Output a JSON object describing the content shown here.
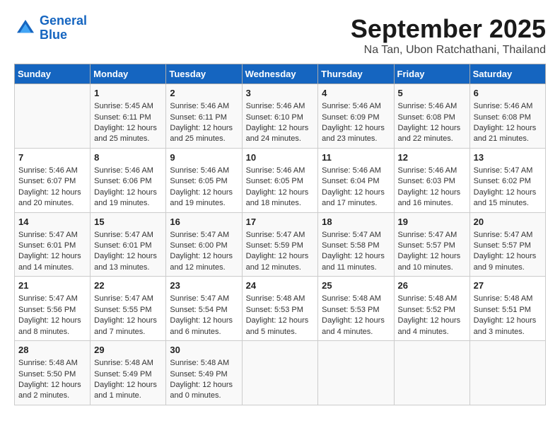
{
  "header": {
    "logo_line1": "General",
    "logo_line2": "Blue",
    "month": "September 2025",
    "location": "Na Tan, Ubon Ratchathani, Thailand"
  },
  "days_of_week": [
    "Sunday",
    "Monday",
    "Tuesday",
    "Wednesday",
    "Thursday",
    "Friday",
    "Saturday"
  ],
  "weeks": [
    [
      {
        "day": "",
        "info": ""
      },
      {
        "day": "1",
        "info": "Sunrise: 5:45 AM\nSunset: 6:11 PM\nDaylight: 12 hours\nand 25 minutes."
      },
      {
        "day": "2",
        "info": "Sunrise: 5:46 AM\nSunset: 6:11 PM\nDaylight: 12 hours\nand 25 minutes."
      },
      {
        "day": "3",
        "info": "Sunrise: 5:46 AM\nSunset: 6:10 PM\nDaylight: 12 hours\nand 24 minutes."
      },
      {
        "day": "4",
        "info": "Sunrise: 5:46 AM\nSunset: 6:09 PM\nDaylight: 12 hours\nand 23 minutes."
      },
      {
        "day": "5",
        "info": "Sunrise: 5:46 AM\nSunset: 6:08 PM\nDaylight: 12 hours\nand 22 minutes."
      },
      {
        "day": "6",
        "info": "Sunrise: 5:46 AM\nSunset: 6:08 PM\nDaylight: 12 hours\nand 21 minutes."
      }
    ],
    [
      {
        "day": "7",
        "info": "Sunrise: 5:46 AM\nSunset: 6:07 PM\nDaylight: 12 hours\nand 20 minutes."
      },
      {
        "day": "8",
        "info": "Sunrise: 5:46 AM\nSunset: 6:06 PM\nDaylight: 12 hours\nand 19 minutes."
      },
      {
        "day": "9",
        "info": "Sunrise: 5:46 AM\nSunset: 6:05 PM\nDaylight: 12 hours\nand 19 minutes."
      },
      {
        "day": "10",
        "info": "Sunrise: 5:46 AM\nSunset: 6:05 PM\nDaylight: 12 hours\nand 18 minutes."
      },
      {
        "day": "11",
        "info": "Sunrise: 5:46 AM\nSunset: 6:04 PM\nDaylight: 12 hours\nand 17 minutes."
      },
      {
        "day": "12",
        "info": "Sunrise: 5:46 AM\nSunset: 6:03 PM\nDaylight: 12 hours\nand 16 minutes."
      },
      {
        "day": "13",
        "info": "Sunrise: 5:47 AM\nSunset: 6:02 PM\nDaylight: 12 hours\nand 15 minutes."
      }
    ],
    [
      {
        "day": "14",
        "info": "Sunrise: 5:47 AM\nSunset: 6:01 PM\nDaylight: 12 hours\nand 14 minutes."
      },
      {
        "day": "15",
        "info": "Sunrise: 5:47 AM\nSunset: 6:01 PM\nDaylight: 12 hours\nand 13 minutes."
      },
      {
        "day": "16",
        "info": "Sunrise: 5:47 AM\nSunset: 6:00 PM\nDaylight: 12 hours\nand 12 minutes."
      },
      {
        "day": "17",
        "info": "Sunrise: 5:47 AM\nSunset: 5:59 PM\nDaylight: 12 hours\nand 12 minutes."
      },
      {
        "day": "18",
        "info": "Sunrise: 5:47 AM\nSunset: 5:58 PM\nDaylight: 12 hours\nand 11 minutes."
      },
      {
        "day": "19",
        "info": "Sunrise: 5:47 AM\nSunset: 5:57 PM\nDaylight: 12 hours\nand 10 minutes."
      },
      {
        "day": "20",
        "info": "Sunrise: 5:47 AM\nSunset: 5:57 PM\nDaylight: 12 hours\nand 9 minutes."
      }
    ],
    [
      {
        "day": "21",
        "info": "Sunrise: 5:47 AM\nSunset: 5:56 PM\nDaylight: 12 hours\nand 8 minutes."
      },
      {
        "day": "22",
        "info": "Sunrise: 5:47 AM\nSunset: 5:55 PM\nDaylight: 12 hours\nand 7 minutes."
      },
      {
        "day": "23",
        "info": "Sunrise: 5:47 AM\nSunset: 5:54 PM\nDaylight: 12 hours\nand 6 minutes."
      },
      {
        "day": "24",
        "info": "Sunrise: 5:48 AM\nSunset: 5:53 PM\nDaylight: 12 hours\nand 5 minutes."
      },
      {
        "day": "25",
        "info": "Sunrise: 5:48 AM\nSunset: 5:53 PM\nDaylight: 12 hours\nand 4 minutes."
      },
      {
        "day": "26",
        "info": "Sunrise: 5:48 AM\nSunset: 5:52 PM\nDaylight: 12 hours\nand 4 minutes."
      },
      {
        "day": "27",
        "info": "Sunrise: 5:48 AM\nSunset: 5:51 PM\nDaylight: 12 hours\nand 3 minutes."
      }
    ],
    [
      {
        "day": "28",
        "info": "Sunrise: 5:48 AM\nSunset: 5:50 PM\nDaylight: 12 hours\nand 2 minutes."
      },
      {
        "day": "29",
        "info": "Sunrise: 5:48 AM\nSunset: 5:49 PM\nDaylight: 12 hours\nand 1 minute."
      },
      {
        "day": "30",
        "info": "Sunrise: 5:48 AM\nSunset: 5:49 PM\nDaylight: 12 hours\nand 0 minutes."
      },
      {
        "day": "",
        "info": ""
      },
      {
        "day": "",
        "info": ""
      },
      {
        "day": "",
        "info": ""
      },
      {
        "day": "",
        "info": ""
      }
    ]
  ]
}
